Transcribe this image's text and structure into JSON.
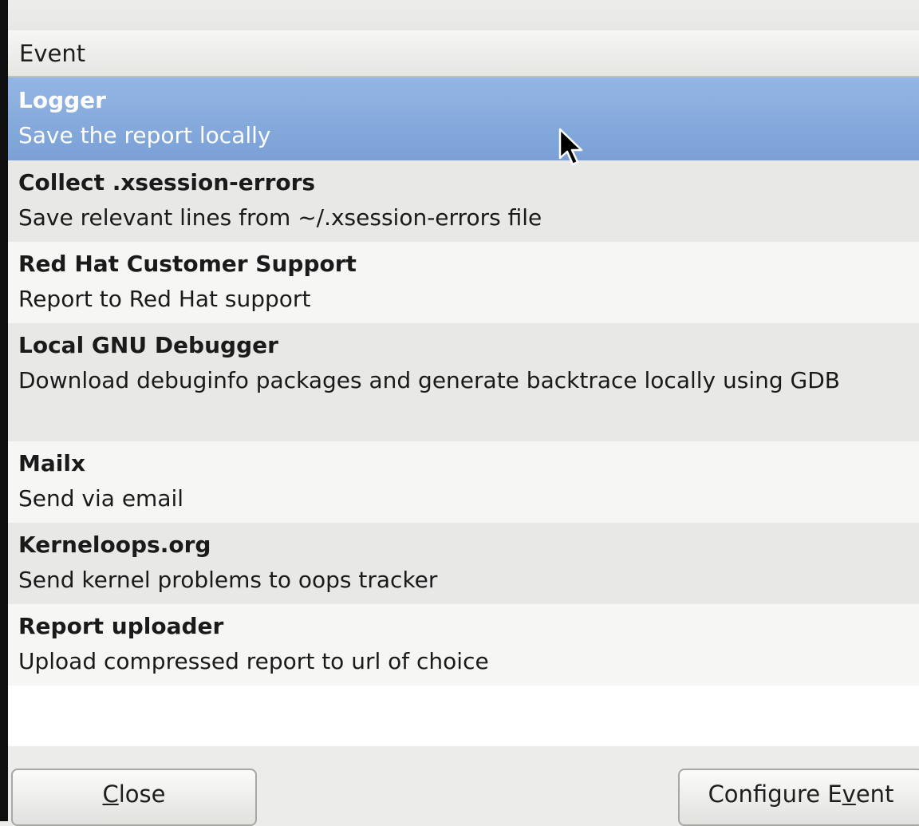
{
  "list": {
    "column_header": "Event",
    "events": [
      {
        "title": "Logger",
        "description": "Save the report locally",
        "selected": true
      },
      {
        "title": "Collect .xsession-errors",
        "description": "Save relevant lines from ~/.xsession-errors file",
        "selected": false
      },
      {
        "title": "Red Hat Customer Support",
        "description": "Report to Red Hat support",
        "selected": false
      },
      {
        "title": "Local GNU Debugger",
        "description": "Download debuginfo packages and generate backtrace locally using GDB",
        "selected": false
      },
      {
        "title": "Mailx",
        "description": "Send via email",
        "selected": false
      },
      {
        "title": "Kerneloops.org",
        "description": "Send kernel problems to oops tracker",
        "selected": false
      },
      {
        "title": "Report uploader",
        "description": "Upload compressed report to url of choice",
        "selected": false
      }
    ]
  },
  "buttons": {
    "close": {
      "label": "Close",
      "mnemonic": "C"
    },
    "configure_event": {
      "label": "Configure Event",
      "mnemonic": "v"
    }
  },
  "icons": {
    "cursor": "mouse-pointer-icon"
  },
  "colors": {
    "selection": "#7aa0d6",
    "row_alt": "#e8e8e6",
    "row": "#f6f6f4"
  }
}
